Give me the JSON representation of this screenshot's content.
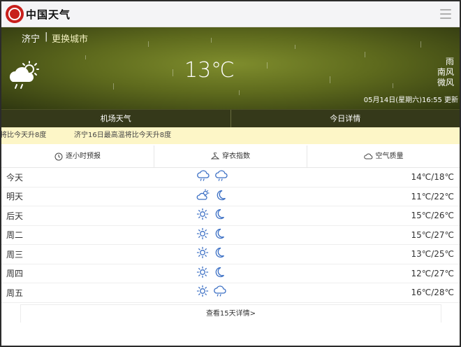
{
  "header": {
    "app_title": "中国天气",
    "logo_text": "中国天气"
  },
  "current": {
    "city": "济宁",
    "separator": "|",
    "change_city": "更换城市",
    "temperature": "13℃",
    "weather": "雨",
    "wind_direction": "南风",
    "wind_level": "微风",
    "update_time": "05月14日(星期六)16:55 更新",
    "icon": "rain-cloud-icon"
  },
  "tabs_top": [
    "机场天气",
    "今日详情"
  ],
  "ticker": {
    "item1": "将比今天升8度",
    "item2": "济宁16日最高温将比今天升8度"
  },
  "tabs_mid": [
    {
      "label": "逐小时预报",
      "icon": "clock-icon"
    },
    {
      "label": "穿衣指数",
      "icon": "hanger-icon"
    },
    {
      "label": "空气质量",
      "icon": "cloud-icon"
    }
  ],
  "forecast": [
    {
      "day": "今天",
      "range": "14℃/18℃",
      "day_icon": "rain-cloud-icon",
      "night_icon": "rain-cloud-icon"
    },
    {
      "day": "明天",
      "range": "11℃/22℃",
      "day_icon": "partly-cloudy-icon",
      "night_icon": "moon-icon"
    },
    {
      "day": "后天",
      "range": "15℃/26℃",
      "day_icon": "sun-icon",
      "night_icon": "moon-icon"
    },
    {
      "day": "周二",
      "range": "15℃/27℃",
      "day_icon": "sun-icon",
      "night_icon": "moon-icon"
    },
    {
      "day": "周三",
      "range": "13℃/25℃",
      "day_icon": "sun-icon",
      "night_icon": "moon-icon"
    },
    {
      "day": "周四",
      "range": "12℃/27℃",
      "day_icon": "sun-icon",
      "night_icon": "moon-icon"
    },
    {
      "day": "周五",
      "range": "16℃/28℃",
      "day_icon": "sun-icon",
      "night_icon": "rain-cloud-icon"
    }
  ],
  "more_link": "查看15天详情>",
  "colors": {
    "icon_blue": "#3b6fc4",
    "ticker_bg": "#fdf6c7",
    "logo_red": "#c8201c"
  }
}
